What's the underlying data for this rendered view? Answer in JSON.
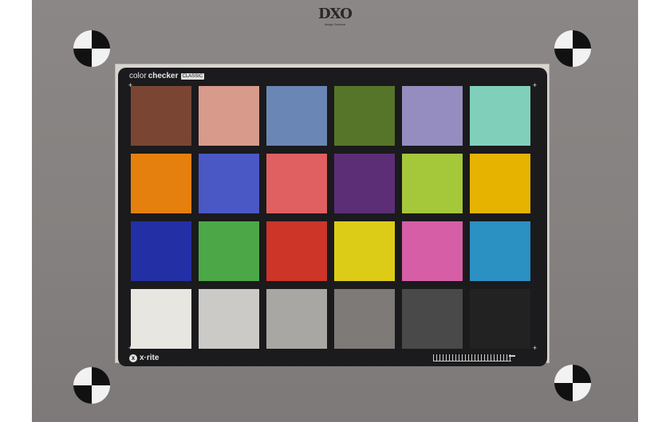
{
  "logo": {
    "text": "DXO",
    "subtext": "Image Science"
  },
  "card": {
    "brand_regular": "color",
    "brand_bold": "checker",
    "brand_badge": "CLASSIC",
    "maker_mark": "x",
    "maker": "x·rite"
  },
  "patches": [
    {
      "row": 1,
      "col": 1,
      "color": "#7a4633"
    },
    {
      "row": 1,
      "col": 2,
      "color": "#d89a8a"
    },
    {
      "row": 1,
      "col": 3,
      "color": "#6a86b4"
    },
    {
      "row": 1,
      "col": 4,
      "color": "#567529"
    },
    {
      "row": 1,
      "col": 5,
      "color": "#958dbf"
    },
    {
      "row": 1,
      "col": 6,
      "color": "#7fcfbb"
    },
    {
      "row": 2,
      "col": 1,
      "color": "#e5800f"
    },
    {
      "row": 2,
      "col": 2,
      "color": "#4a58c5"
    },
    {
      "row": 2,
      "col": 3,
      "color": "#e05f60"
    },
    {
      "row": 2,
      "col": 4,
      "color": "#5b2e76"
    },
    {
      "row": 2,
      "col": 5,
      "color": "#a5c73a"
    },
    {
      "row": 2,
      "col": 6,
      "color": "#e5b300"
    },
    {
      "row": 3,
      "col": 1,
      "color": "#232fa5"
    },
    {
      "row": 3,
      "col": 2,
      "color": "#4ca847"
    },
    {
      "row": 3,
      "col": 3,
      "color": "#cc3528"
    },
    {
      "row": 3,
      "col": 4,
      "color": "#ddcc17"
    },
    {
      "row": 3,
      "col": 5,
      "color": "#d65ea6"
    },
    {
      "row": 3,
      "col": 6,
      "color": "#2b90c2"
    },
    {
      "row": 4,
      "col": 1,
      "color": "#e8e6e1"
    },
    {
      "row": 4,
      "col": 2,
      "color": "#cbcac6"
    },
    {
      "row": 4,
      "col": 3,
      "color": "#a8a7a3"
    },
    {
      "row": 4,
      "col": 4,
      "color": "#7d7a77"
    },
    {
      "row": 4,
      "col": 5,
      "color": "#4a4949"
    },
    {
      "row": 4,
      "col": 6,
      "color": "#222222"
    }
  ],
  "markers": {
    "target_icon": "registration-target-icon",
    "cross_icon": "crosshair-icon",
    "cross_glyph": "+"
  }
}
